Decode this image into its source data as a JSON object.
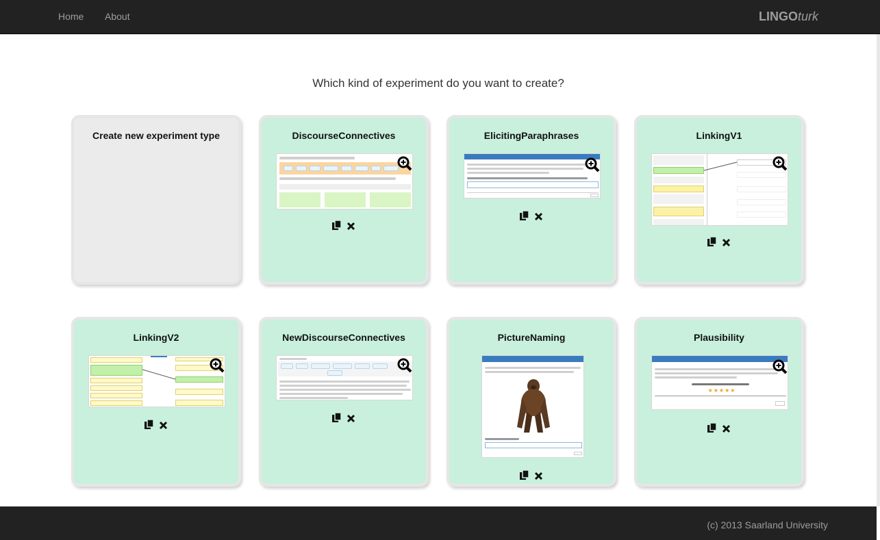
{
  "nav": {
    "home": "Home",
    "about": "About",
    "brand_bold": "LINGO",
    "brand_italic": "turk"
  },
  "heading": "Which kind of experiment do you want to create?",
  "cards": [
    {
      "title": "Create new experiment type"
    },
    {
      "title": "DiscourseConnectives"
    },
    {
      "title": "ElicitingParaphrases"
    },
    {
      "title": "LinkingV1"
    },
    {
      "title": "LinkingV2"
    },
    {
      "title": "NewDiscourseConnectives"
    },
    {
      "title": "PictureNaming"
    },
    {
      "title": "Plausibility"
    }
  ],
  "actions": {
    "copy_icon": "copy-icon",
    "delete_icon": "delete-icon",
    "zoom_icon": "zoom-icon"
  },
  "footer": "(c) 2013 Saarland University"
}
